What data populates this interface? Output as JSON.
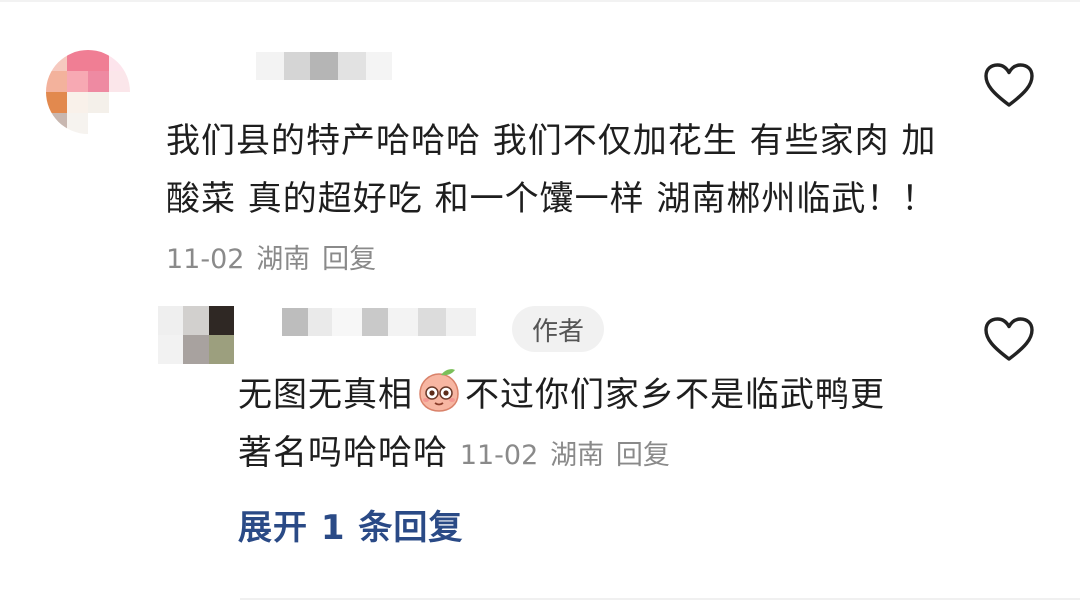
{
  "comments": [
    {
      "text": "我们县的特产哈哈哈 我们不仅加花生 有些家肉 加酸菜 真的超好吃 和一个馕一样 湖南郴州临武！！",
      "date": "11-02",
      "location": "湖南",
      "reply_label": "回复",
      "like_icon": "heart-outline-icon"
    }
  ],
  "reply": {
    "badge": "作者",
    "text_before": "无图无真相",
    "emoji": "peach-face-emoji",
    "text_after": "不过你们家乡不是临武鸭更著名吗哈哈哈",
    "date": "11-02",
    "location": "湖南",
    "reply_label": "回复",
    "like_icon": "heart-outline-icon"
  },
  "expand_label": "展开 1 条回复",
  "colors": {
    "text": "#1e1e1e",
    "meta": "#8a8a8a",
    "link": "#2a4a86",
    "badge_bg": "#f1f1f1"
  }
}
